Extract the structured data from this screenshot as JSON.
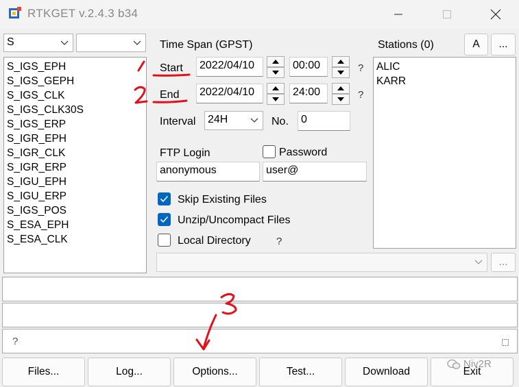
{
  "window": {
    "title": "RTKGET v.2.4.3 b34"
  },
  "left_panel": {
    "type_combo": "S",
    "subtype_combo": "",
    "products": [
      "S_IGS_EPH",
      "S_IGS_GEPH",
      "S_IGS_CLK",
      "S_IGS_CLK30S",
      "S_IGS_ERP",
      "S_IGR_EPH",
      "S_IGR_CLK",
      "S_IGR_ERP",
      "S_IGU_EPH",
      "S_IGU_ERP",
      "S_IGS_POS",
      "S_ESA_EPH",
      "S_ESA_CLK"
    ]
  },
  "time_span": {
    "label": "Time Span (GPST)",
    "start_label": "Start",
    "start_date": "2022/04/10",
    "start_time": "00:00",
    "end_label": "End",
    "end_date": "2022/04/10",
    "end_time": "24:00",
    "help": "?",
    "interval_label": "Interval",
    "interval_value": "24H",
    "no_label": "No.",
    "no_value": "0"
  },
  "login": {
    "ftp_label": "FTP Login",
    "password_label": "Password",
    "password_checked": false,
    "user": "anonymous",
    "password": "user@"
  },
  "options": {
    "skip_label": "Skip Existing Files",
    "skip_checked": true,
    "unzip_label": "Unzip/Uncompact Files",
    "unzip_checked": true,
    "local_label": "Local Directory",
    "local_checked": false,
    "local_help": "?",
    "directory": "",
    "browse_label": "..."
  },
  "stations": {
    "label": "Stations (0)",
    "a_button": "A",
    "more_button": "...",
    "items": [
      "ALIC",
      "KARR"
    ]
  },
  "status": {
    "line1": "",
    "line2": "",
    "line3": "?"
  },
  "buttons": {
    "files": "Files...",
    "log": "Log...",
    "options": "Options...",
    "test": "Test...",
    "download": "Download",
    "exit": "Exit"
  },
  "annotations": {
    "mark1": "1",
    "mark2": "2",
    "mark3": "3",
    "watermark": "Niv2R",
    "color": "#e3101a"
  }
}
